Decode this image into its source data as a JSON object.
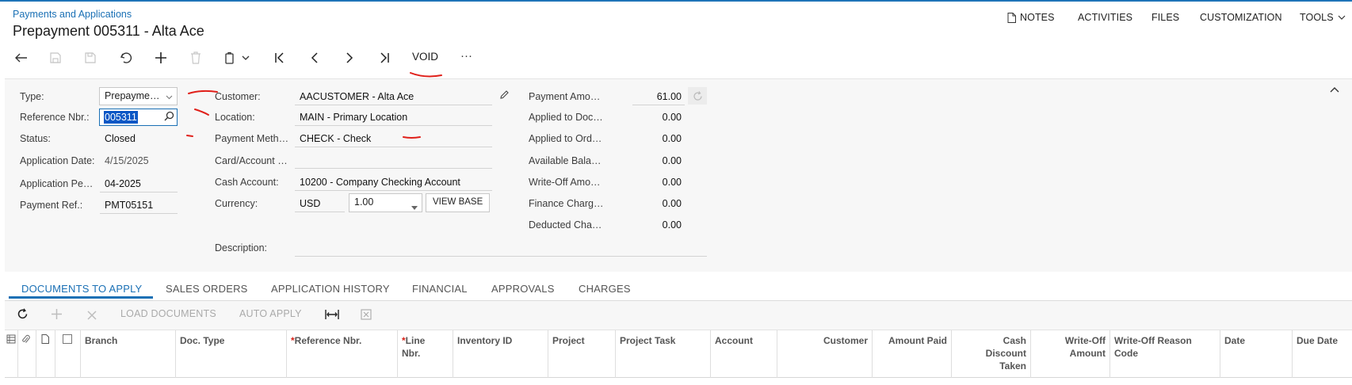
{
  "breadcrumb": "Payments and Applications",
  "title": "Prepayment 005311 - Alta Ace",
  "top_menu": {
    "notes": "NOTES",
    "activities": "ACTIVITIES",
    "files": "FILES",
    "customization": "CUSTOMIZATION",
    "tools": "TOOLS"
  },
  "toolbar": {
    "void_label": "VOID",
    "more_label": "···"
  },
  "form": {
    "type_label": "Type:",
    "type_value": "Prepayme…",
    "ref_label": "Reference Nbr.:",
    "ref_value": "005311",
    "status_label": "Status:",
    "status_value": "Closed",
    "app_date_label": "Application Date:",
    "app_date_value": "4/15/2025",
    "app_period_label": "Application Pe…",
    "app_period_value": "04-2025",
    "payment_ref_label": "Payment Ref.:",
    "payment_ref_value": "PMT05151",
    "customer_label": "Customer:",
    "customer_value": "AACUSTOMER - Alta Ace",
    "location_label": "Location:",
    "location_value": "MAIN - Primary Location",
    "payment_method_label": "Payment Meth…",
    "payment_method_value": "CHECK - Check",
    "card_label": "Card/Account …",
    "cash_account_label": "Cash Account:",
    "cash_account_value": "10200 - Company Checking Account",
    "currency_label": "Currency:",
    "currency_value": "USD",
    "currency_rate": "1.00",
    "view_base_label": "VIEW BASE",
    "description_label": "Description:"
  },
  "amounts": [
    {
      "label": "Payment Amo…",
      "value": "61.00"
    },
    {
      "label": "Applied to Doc…",
      "value": "0.00"
    },
    {
      "label": "Applied to Ord…",
      "value": "0.00"
    },
    {
      "label": "Available Bala…",
      "value": "0.00"
    },
    {
      "label": "Write-Off Amo…",
      "value": "0.00"
    },
    {
      "label": "Finance Charg…",
      "value": "0.00"
    },
    {
      "label": "Deducted Cha…",
      "value": "0.00"
    }
  ],
  "tabs": [
    {
      "label": "DOCUMENTS TO APPLY"
    },
    {
      "label": "SALES ORDERS"
    },
    {
      "label": "APPLICATION HISTORY"
    },
    {
      "label": "FINANCIAL"
    },
    {
      "label": "APPROVALS"
    },
    {
      "label": "CHARGES"
    }
  ],
  "grid_toolbar": {
    "load_documents": "LOAD DOCUMENTS",
    "auto_apply": "AUTO APPLY"
  },
  "columns": {
    "branch": "Branch",
    "doc_type": "Doc. Type",
    "reference_nbr": "Reference Nbr.",
    "line_nbr_1": "Line",
    "line_nbr_2": "Nbr.",
    "inventory_id": "Inventory ID",
    "project": "Project",
    "project_task": "Project Task",
    "account": "Account",
    "customer": "Customer",
    "amount_paid": "Amount Paid",
    "cash_discount_1": "Cash",
    "cash_discount_2": "Discount",
    "cash_discount_3": "Taken",
    "write_off_amount_1": "Write-Off",
    "write_off_amount_2": "Amount",
    "write_off_reason_1": "Write-Off Reason",
    "write_off_reason_2": "Code",
    "date": "Date",
    "due_date": "Due Date"
  },
  "colors": {
    "accent": "#1a70b5",
    "required": "#d9241a",
    "annotation": "#e0201a",
    "selection": "#0b57c5"
  }
}
